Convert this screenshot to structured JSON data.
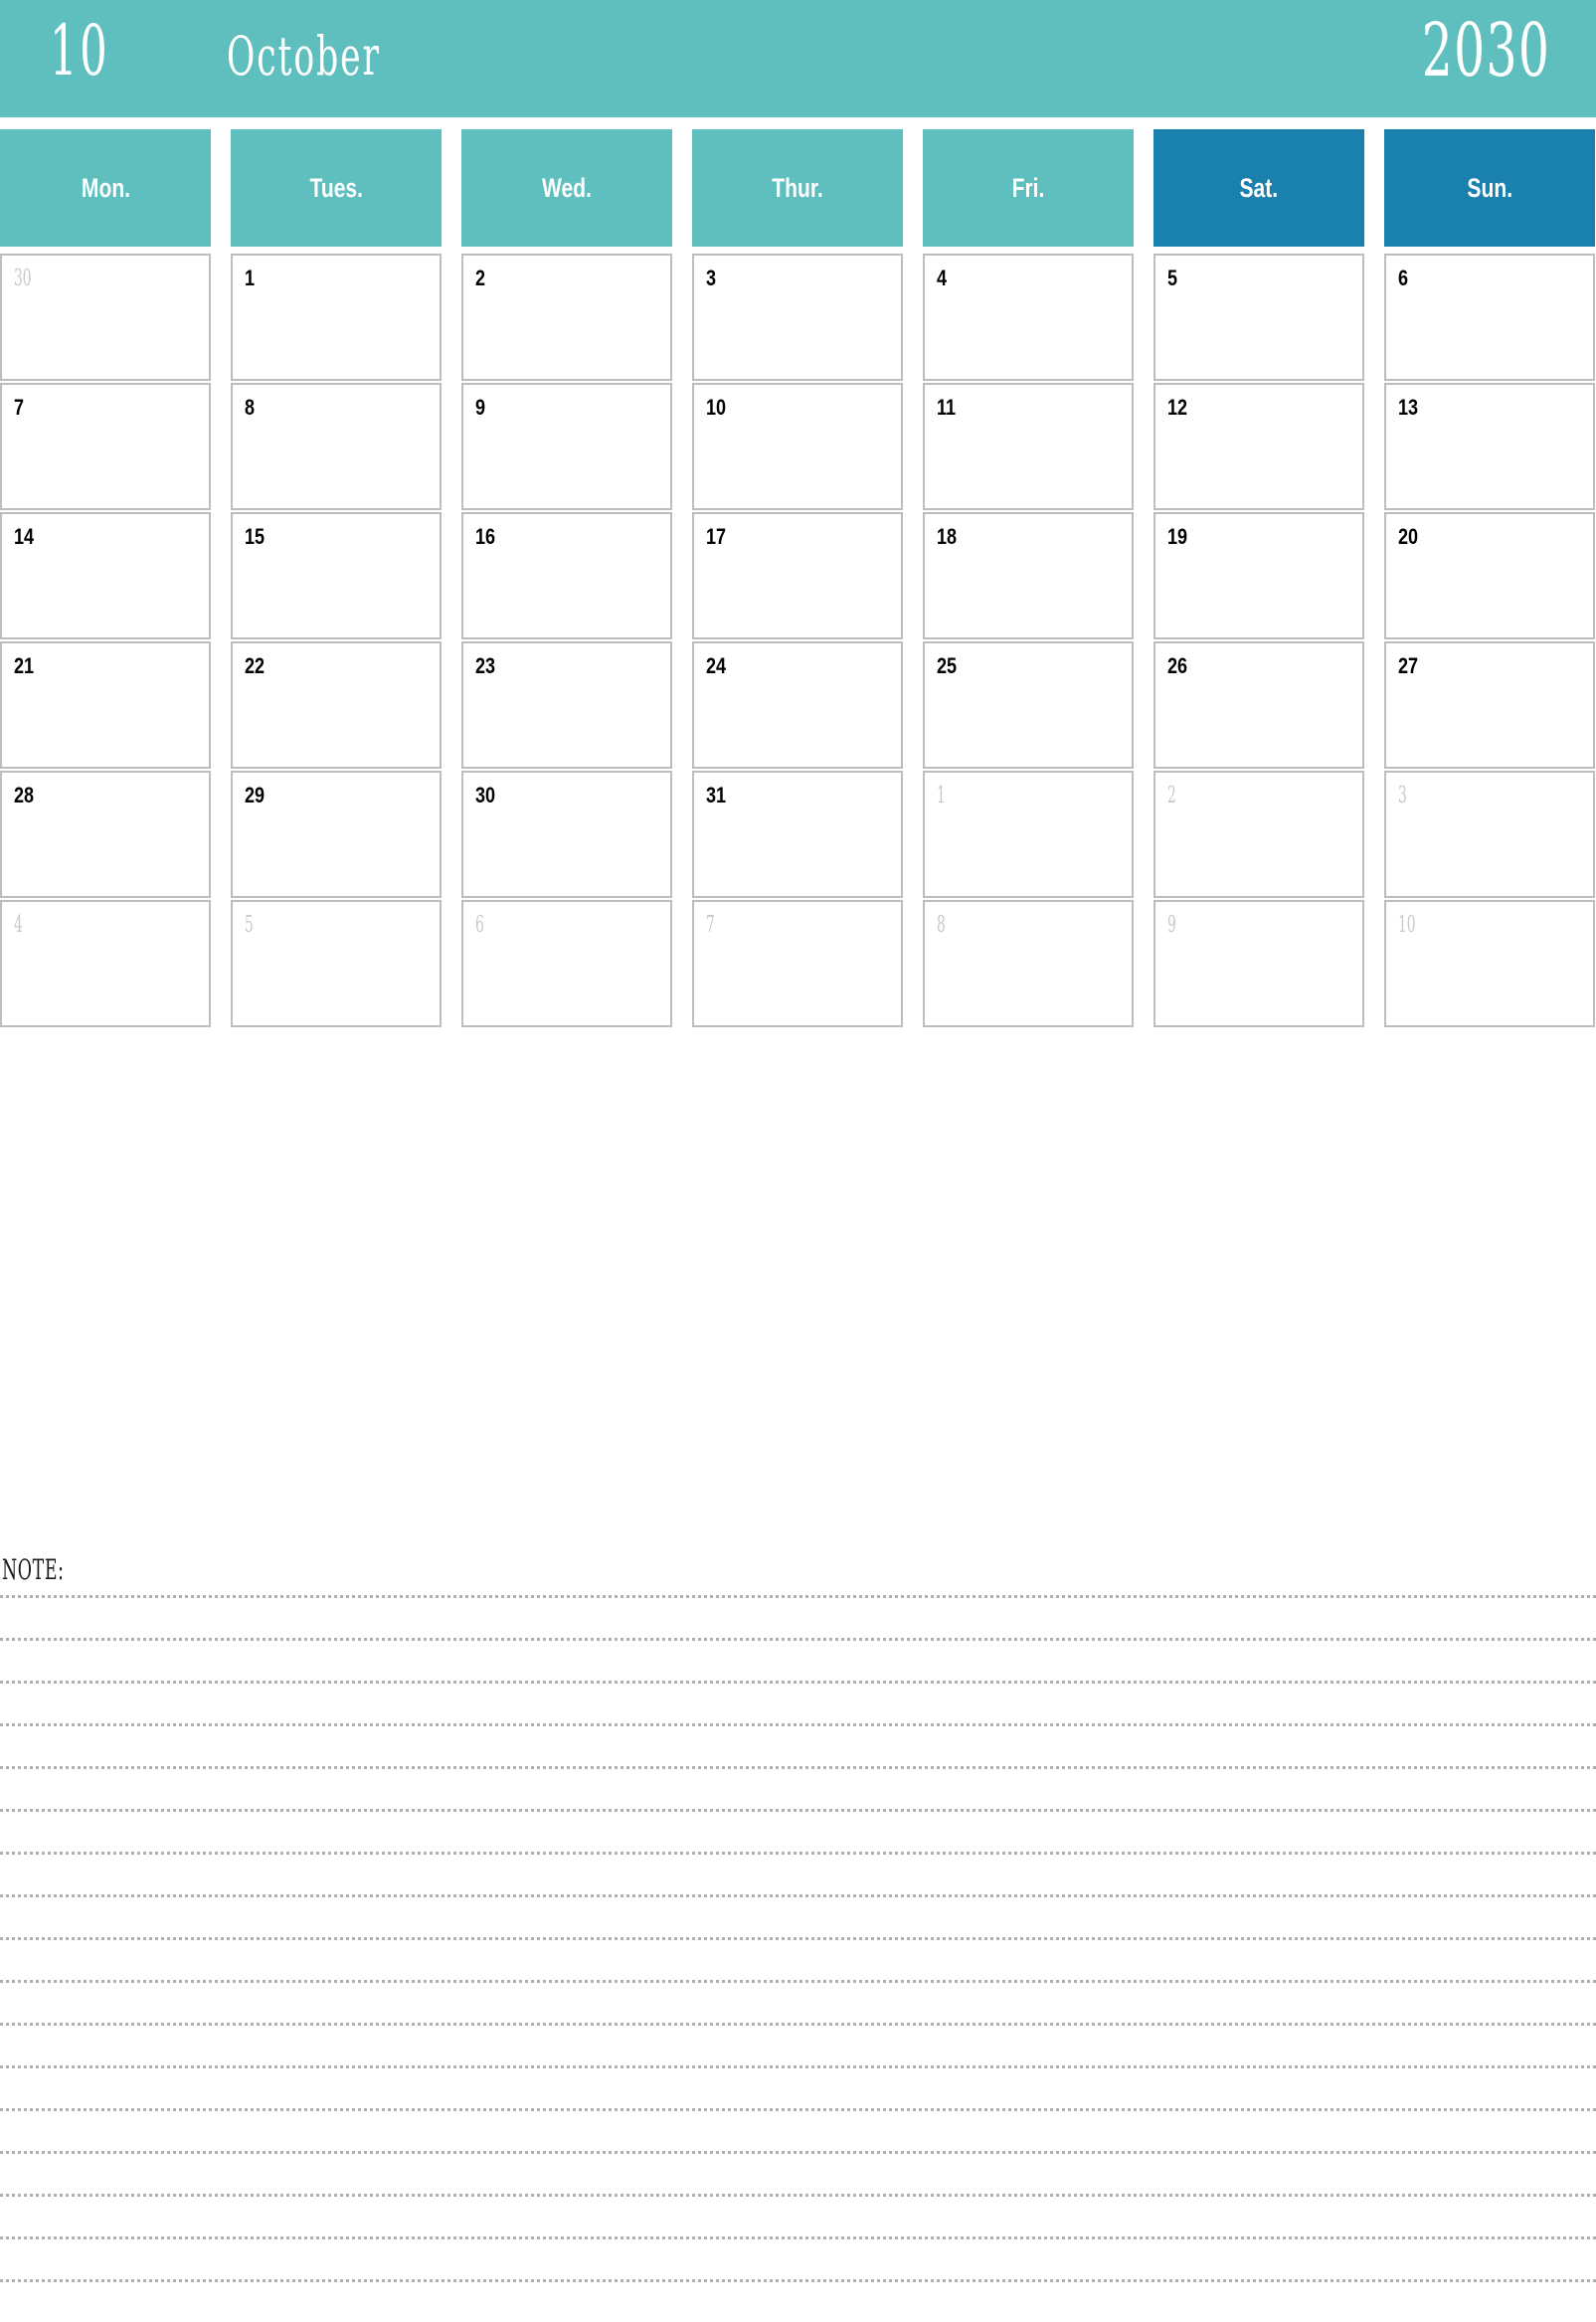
{
  "header": {
    "month_number": "10",
    "month_name": "October",
    "year": "2030",
    "background_color": "#5FBEBE",
    "text_color": "#FFFFFF"
  },
  "colors": {
    "teal": "#5FBEBE",
    "weekend_blue": "#1A80AE",
    "cell_border": "#BDBDBD",
    "muted_date": "#C8C8C8",
    "active_date": "#000000",
    "note_rule": "#AFAFAF"
  },
  "weekdays": [
    {
      "label": "Mon.",
      "weekend": false
    },
    {
      "label": "Tues.",
      "weekend": false
    },
    {
      "label": "Wed.",
      "weekend": false
    },
    {
      "label": "Thur.",
      "weekend": false
    },
    {
      "label": "Fri.",
      "weekend": false
    },
    {
      "label": "Sat.",
      "weekend": true
    },
    {
      "label": "Sun.",
      "weekend": true
    }
  ],
  "weeks": [
    [
      {
        "day": "30",
        "muted": true
      },
      {
        "day": "1",
        "muted": false
      },
      {
        "day": "2",
        "muted": false
      },
      {
        "day": "3",
        "muted": false
      },
      {
        "day": "4",
        "muted": false
      },
      {
        "day": "5",
        "muted": false
      },
      {
        "day": "6",
        "muted": false
      }
    ],
    [
      {
        "day": "7",
        "muted": false
      },
      {
        "day": "8",
        "muted": false
      },
      {
        "day": "9",
        "muted": false
      },
      {
        "day": "10",
        "muted": false
      },
      {
        "day": "11",
        "muted": false
      },
      {
        "day": "12",
        "muted": false
      },
      {
        "day": "13",
        "muted": false
      }
    ],
    [
      {
        "day": "14",
        "muted": false
      },
      {
        "day": "15",
        "muted": false
      },
      {
        "day": "16",
        "muted": false
      },
      {
        "day": "17",
        "muted": false
      },
      {
        "day": "18",
        "muted": false
      },
      {
        "day": "19",
        "muted": false
      },
      {
        "day": "20",
        "muted": false
      }
    ],
    [
      {
        "day": "21",
        "muted": false
      },
      {
        "day": "22",
        "muted": false
      },
      {
        "day": "23",
        "muted": false
      },
      {
        "day": "24",
        "muted": false
      },
      {
        "day": "25",
        "muted": false
      },
      {
        "day": "26",
        "muted": false
      },
      {
        "day": "27",
        "muted": false
      }
    ],
    [
      {
        "day": "28",
        "muted": false
      },
      {
        "day": "29",
        "muted": false
      },
      {
        "day": "30",
        "muted": false
      },
      {
        "day": "31",
        "muted": false
      },
      {
        "day": "1",
        "muted": true
      },
      {
        "day": "2",
        "muted": true
      },
      {
        "day": "3",
        "muted": true
      }
    ],
    [
      {
        "day": "4",
        "muted": true
      },
      {
        "day": "5",
        "muted": true
      },
      {
        "day": "6",
        "muted": true
      },
      {
        "day": "7",
        "muted": true
      },
      {
        "day": "8",
        "muted": true
      },
      {
        "day": "9",
        "muted": true
      },
      {
        "day": "10",
        "muted": true
      }
    ]
  ],
  "note": {
    "label": "NOTE:",
    "line_count": 17
  }
}
